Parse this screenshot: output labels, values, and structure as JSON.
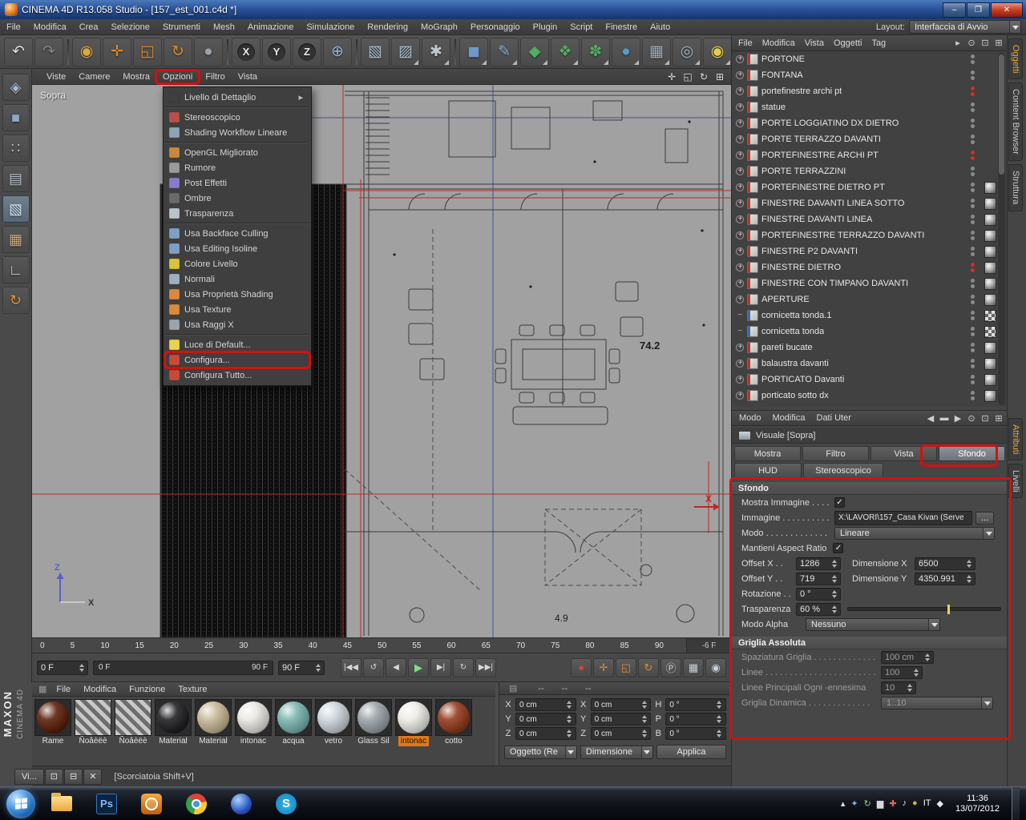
{
  "window": {
    "title": "CINEMA 4D R13.058 Studio - [157_est_001.c4d *]",
    "controls": [
      {
        "name": "minimize",
        "glyph": "–"
      },
      {
        "name": "maximize",
        "glyph": "❐"
      },
      {
        "name": "close",
        "glyph": "✕"
      }
    ]
  },
  "menubar": {
    "items": [
      "File",
      "Modifica",
      "Crea",
      "Selezione",
      "Strumenti",
      "Mesh",
      "Animazione",
      "Simulazione",
      "Rendering",
      "MoGraph",
      "Personaggio",
      "Plugin",
      "Script",
      "Finestre",
      "Aiuto"
    ],
    "layout_label": "Layout:",
    "layout_value": "Interfaccia di Avvio"
  },
  "toolbar": {
    "buttons": [
      {
        "name": "undo",
        "glyph": "↶",
        "color": "#d8dce0"
      },
      {
        "name": "redo",
        "glyph": "↷",
        "color": "#85878a"
      },
      {
        "sep": true
      },
      {
        "name": "live-selection",
        "glyph": "◉",
        "color": "#dca83c"
      },
      {
        "name": "move",
        "glyph": "✛",
        "color": "#e08a2e"
      },
      {
        "name": "scale",
        "glyph": "◱",
        "color": "#e08a2e"
      },
      {
        "name": "rotate",
        "glyph": "↻",
        "color": "#e08a2e"
      },
      {
        "name": "last-tool",
        "glyph": "●",
        "color": "#9aa2aa"
      },
      {
        "sep": true
      },
      {
        "name": "lock-x",
        "glyph": "X",
        "color": "#e8e8e8",
        "badge": true
      },
      {
        "name": "lock-y",
        "glyph": "Y",
        "color": "#e8e8e8",
        "badge": true
      },
      {
        "name": "lock-z",
        "glyph": "Z",
        "color": "#e8e8e8",
        "badge": true
      },
      {
        "name": "coord-system",
        "glyph": "⊕",
        "color": "#8fb3d8"
      },
      {
        "sep": true
      },
      {
        "name": "render-view",
        "glyph": "▧",
        "color": "#a8c0d0"
      },
      {
        "name": "render-picture-viewer",
        "glyph": "▨",
        "color": "#a8c0d0",
        "dropdown": true
      },
      {
        "name": "render-settings",
        "glyph": "✱",
        "color": "#c0c8d0",
        "dropdown": true
      },
      {
        "sep": true
      },
      {
        "name": "add-cube",
        "glyph": "◼",
        "color": "#6f97cc",
        "dropdown": true
      },
      {
        "name": "add-spline",
        "glyph": "✎",
        "color": "#7fb3e0",
        "dropdown": true
      },
      {
        "name": "add-generator",
        "glyph": "◆",
        "color": "#4fae62",
        "dropdown": true
      },
      {
        "name": "add-modeling",
        "glyph": "❖",
        "color": "#4fae62",
        "dropdown": true
      },
      {
        "name": "add-deformer",
        "glyph": "✽",
        "color": "#4fae62",
        "dropdown": true
      },
      {
        "name": "add-environment",
        "glyph": "●",
        "color": "#4f9ecc",
        "dropdown": true
      },
      {
        "name": "add-stage",
        "glyph": "▦",
        "color": "#9fb0c0",
        "dropdown": true
      },
      {
        "name": "add-camera",
        "glyph": "◎",
        "color": "#9fb0c0",
        "dropdown": true
      },
      {
        "name": "add-light",
        "glyph": "◉",
        "color": "#e8cc4a",
        "dropdown": true
      }
    ]
  },
  "left_palette": {
    "buttons": [
      {
        "name": "make-editable",
        "glyph": "◈",
        "color": "#a8b8c8"
      },
      {
        "name": "model-mode",
        "glyph": "■",
        "color": "#8fa8c8"
      },
      {
        "name": "point-mode",
        "glyph": "∷",
        "color": "#b8c0c8"
      },
      {
        "name": "edge-mode",
        "glyph": "▤",
        "color": "#b8c0c8"
      },
      {
        "name": "polygon-mode",
        "glyph": "▧",
        "color": "#d8e8f8",
        "active": true
      },
      {
        "name": "texture-mode",
        "glyph": "▦",
        "color": "#c8a87f"
      },
      {
        "name": "workplane-mode",
        "glyph": "∟",
        "color": "#d0d0d0"
      },
      {
        "name": "axis-mode",
        "glyph": "↻",
        "color": "#e0922e"
      }
    ]
  },
  "viewport": {
    "label": "Sopra",
    "menus": [
      {
        "label": "Viste"
      },
      {
        "label": "Camere"
      },
      {
        "label": "Mostra"
      },
      {
        "label": "Opzioni",
        "boxed": true
      },
      {
        "label": "Filtro"
      },
      {
        "label": "Vista"
      }
    ],
    "corner_icons": [
      {
        "name": "pan-view-icon",
        "glyph": "✛"
      },
      {
        "name": "zoom-view-icon",
        "glyph": "◱"
      },
      {
        "name": "rotate-view-icon",
        "glyph": "↻"
      },
      {
        "name": "maximize-view-icon",
        "glyph": "⊞"
      }
    ],
    "dim_a": "74.2",
    "dim_b": "4.9",
    "axis_x": "X",
    "axis_z": "Z",
    "red_axis_label": "X"
  },
  "options_menu": {
    "items": [
      {
        "label": "Livello di Dettaglio",
        "submenu": true,
        "group_end": true
      },
      {
        "label": "Stereoscopico",
        "icon_color": "#b85048"
      },
      {
        "label": "Shading Workflow Lineare",
        "icon_color": "#8fa3b8",
        "group_end": true
      },
      {
        "label": "OpenGL Migliorato",
        "icon_color": "#c9893a"
      },
      {
        "label": "Rumore",
        "icon_color": "#9a9a9a"
      },
      {
        "label": "Post Effetti",
        "icon_color": "#8a7ac9"
      },
      {
        "label": "Ombre",
        "icon_color": "#6a6a6a"
      },
      {
        "label": "Trasparenza",
        "icon_color": "#b8c4cc",
        "group_end": true
      },
      {
        "label": "Usa Backface Culling",
        "icon_color": "#7f9fc4"
      },
      {
        "label": "Usa Editing Isoline",
        "icon_color": "#7f9fc4"
      },
      {
        "label": "Colore Livello",
        "icon_color": "#d9c43a"
      },
      {
        "label": "Normali",
        "icon_color": "#9ab0c4"
      },
      {
        "label": "Usa Proprietà Shading",
        "icon_color": "#d98a3a"
      },
      {
        "label": "Usa Texture",
        "icon_color": "#d98a3a"
      },
      {
        "label": "Usa Raggi X",
        "icon_color": "#9aa5ad",
        "group_end": true
      },
      {
        "label": "Luce di Default...",
        "icon_color": "#e8d44a"
      },
      {
        "label": "Configura...",
        "icon_color": "#c94a3a",
        "boxed": true
      },
      {
        "label": "Configura Tutto...",
        "icon_color": "#c94a3a"
      }
    ]
  },
  "ruler": {
    "ticks": [
      "0",
      "5",
      "10",
      "15",
      "20",
      "25",
      "30",
      "35",
      "40",
      "45",
      "50",
      "55",
      "60",
      "65",
      "70",
      "75",
      "80",
      "85",
      "90"
    ],
    "end_label": "-6 F"
  },
  "timeline": {
    "current": "0 F",
    "range_start": "0 F",
    "range_end": "90 F",
    "end_value": "90 F",
    "playback": [
      {
        "name": "goto-start",
        "glyph": "|◀◀"
      },
      {
        "name": "play-backwards",
        "glyph": "↺"
      },
      {
        "name": "prev-frame",
        "glyph": "◀"
      },
      {
        "name": "play",
        "glyph": "▶",
        "green": true
      },
      {
        "name": "next-frame",
        "glyph": "▶|"
      },
      {
        "name": "play-loop",
        "glyph": "↻"
      },
      {
        "name": "goto-end",
        "glyph": "▶▶|"
      }
    ],
    "record": [
      {
        "name": "record-keyframe",
        "glyph": "●",
        "color": "#d8433a"
      },
      {
        "name": "record-position",
        "glyph": "✛",
        "color": "#e0892e"
      },
      {
        "name": "record-scale",
        "glyph": "◱",
        "color": "#e0892e"
      },
      {
        "name": "record-rotation",
        "glyph": "↻",
        "color": "#e0892e"
      },
      {
        "name": "record-parameter",
        "glyph": "Ⓟ",
        "color": "#c8d0d8"
      },
      {
        "name": "keyframe-selection",
        "glyph": "▦",
        "color": "#c8d0d8"
      },
      {
        "name": "autokey",
        "glyph": "◉",
        "color": "#c8d0d8"
      }
    ]
  },
  "materials": {
    "menus": [
      "File",
      "Modifica",
      "Funzione",
      "Texture"
    ],
    "items": [
      {
        "name": "Rame",
        "color": "#5a1d08"
      },
      {
        "name": "Ñoâèëè",
        "hatch": true
      },
      {
        "name": "Ñoâèëè",
        "hatch": true
      },
      {
        "name": "Material",
        "color": "#1d1d20"
      },
      {
        "name": "Material",
        "color": "#c7b795"
      },
      {
        "name": "intonac",
        "color": "#e9e7e1"
      },
      {
        "name": "acqua",
        "color": "#79b5af"
      },
      {
        "name": "vetro",
        "color": "#ccd5db"
      },
      {
        "name": "Glass Sil",
        "color": "#9aa2a8"
      },
      {
        "name": "intonac",
        "color": "#edebe5",
        "selected": true
      },
      {
        "name": "cotto",
        "color": "#93391b"
      }
    ]
  },
  "coordinates": {
    "header_dash": "--",
    "position": {
      "labels": [
        "X",
        "Y",
        "Z"
      ],
      "values": [
        "0 cm",
        "0 cm",
        "0 cm"
      ]
    },
    "size": {
      "labels": [
        "X",
        "Y",
        "Z"
      ],
      "values": [
        "0 cm",
        "0 cm",
        "0 cm"
      ]
    },
    "rotation": {
      "labels": [
        "H",
        "P",
        "B"
      ],
      "values": [
        "0 °",
        "0 °",
        "0 °"
      ]
    },
    "mode1": "Oggetto (Re",
    "mode2": "Dimensione",
    "apply": "Applica"
  },
  "object_manager": {
    "menus": [
      "File",
      "Modifica",
      "Vista",
      "Oggetti",
      "Tag"
    ],
    "icons": [
      {
        "name": "overflow-arrow-icon",
        "glyph": "▸"
      },
      {
        "name": "search-icon",
        "glyph": "⊙"
      },
      {
        "name": "lock-icon",
        "glyph": "⊡"
      },
      {
        "name": "layout-icon",
        "glyph": "⊞"
      }
    ],
    "objects": [
      {
        "name": "PORTONE"
      },
      {
        "name": "FONTANA"
      },
      {
        "name": "portefinestre archi pt",
        "dots_red": true
      },
      {
        "name": "statue"
      },
      {
        "name": "PORTE LOGGIATINO DX DIETRO"
      },
      {
        "name": "PORTE TERRAZZO DAVANTI"
      },
      {
        "name": "PORTEFINESTRE ARCHI PT",
        "dots_red": true
      },
      {
        "name": "PORTE TERRAZZINI"
      },
      {
        "name": "PORTEFINESTRE DIETRO PT",
        "has_mat": true
      },
      {
        "name": "FINESTRE DAVANTI LINEA SOTTO",
        "has_mat": true
      },
      {
        "name": "FINESTRE DAVANTI LINEA",
        "has_mat": true
      },
      {
        "name": "PORTEFINESTRE TERRAZZO DAVANTI",
        "has_mat": true
      },
      {
        "name": "FINESTRE P2 DAVANTI",
        "has_mat": true
      },
      {
        "name": "FINESTRE DIETRO",
        "dots_red": true,
        "has_mat": true
      },
      {
        "name": "FINESTRE CON TIMPANO DAVANTI",
        "has_mat": true
      },
      {
        "name": "APERTURE",
        "has_mat": true
      },
      {
        "name": "cornicetta tonda.1",
        "has_mat": true,
        "checker": true,
        "spline": true
      },
      {
        "name": "cornicetta tonda",
        "has_mat": true,
        "checker": true,
        "spline": true
      },
      {
        "name": "pareti bucate",
        "has_mat": true
      },
      {
        "name": "balaustra davanti",
        "has_mat": true
      },
      {
        "name": "PORTICATO Davanti",
        "has_mat": true
      },
      {
        "name": "porticato sotto dx",
        "has_mat": true
      }
    ]
  },
  "side_tabs": {
    "top": [
      {
        "label": "Oggetti",
        "active": true
      },
      {
        "label": "Content Browser"
      },
      {
        "label": "Struttura"
      }
    ],
    "bottom": [
      {
        "label": "Attributi",
        "active": true
      },
      {
        "label": "Livelli"
      }
    ]
  },
  "attributes": {
    "menus": [
      "Modo",
      "Modifica",
      "Dati Uter"
    ],
    "icons": [
      {
        "name": "back-icon",
        "glyph": "◀"
      },
      {
        "name": "mode-block-icon",
        "glyph": "▬"
      },
      {
        "name": "forward-icon",
        "glyph": "▶"
      },
      {
        "name": "search-icon",
        "glyph": "⊙"
      },
      {
        "name": "lock-icon",
        "glyph": "⊡"
      },
      {
        "name": "layout-icon",
        "glyph": "⊞"
      }
    ],
    "title": "Visuale [Sopra]",
    "tabs_row1": [
      "Mostra",
      "Filtro",
      "Vista",
      "Sfondo"
    ],
    "tabs_row2": [
      "HUD",
      "Stereoscopico"
    ],
    "active_tab": "Sfondo",
    "sfondo": {
      "header": "Sfondo",
      "mostra_immagine_label": "Mostra Immagine . . . .",
      "immagine_label": "Immagine . . . . . . . . . .",
      "immagine_value": "X:\\LAVORI\\157_Casa Kivan (Serve",
      "browse_label": "...",
      "modo_label": "Modo . . . . . . . . . . . . .",
      "modo_value": "Lineare",
      "aspect_label": "Mantieni Aspect Ratio",
      "offset_x_label": "Offset X . .",
      "offset_x_value": "1286",
      "dim_x_label": "Dimensione X",
      "dim_x_value": "6500",
      "offset_y_label": "Offset Y . .",
      "offset_y_value": "719",
      "dim_y_label": "Dimensione Y",
      "dim_y_value": "4350.991",
      "rot_label": "Rotazione . .",
      "rot_value": "0 °",
      "trasp_label": "Trasparenza",
      "trasp_value": "60 %",
      "alpha_label": "Modo Alpha",
      "alpha_value": "Nessuno"
    },
    "griglia": {
      "header": "Griglia Assoluta",
      "spaziatura_label": "Spaziatura Griglia . . . . . . . . . . . . .",
      "spaziatura_value": "100 cm",
      "linee_label": "Linee . . . . . . . . . . . . . . . . . . . . . . . .",
      "linee_value": "100",
      "principali_label": "Linee Principali Ogni -ennesima",
      "principali_value": "10",
      "dinamica_label": "Griglia Dinamica . . . . . . . . . . . . .",
      "dinamica_value": "1..10"
    }
  },
  "statusbar": {
    "mini_tab": "Vi...",
    "mini_icons": [
      {
        "name": "restore-icon",
        "glyph": "⊡"
      },
      {
        "name": "minimize-icon",
        "glyph": "⊟"
      },
      {
        "name": "close-icon",
        "glyph": "✕"
      }
    ],
    "shortcut": "[Scorciatoia Shift+V]"
  },
  "brand": {
    "maxon": "MAXON",
    "cinema": "CINEMA 4D"
  },
  "taskbar": {
    "photoshop_label": "Ps",
    "skype_label": "S",
    "tray": [
      {
        "name": "hidden-icons",
        "glyph": "▴",
        "color": "#e0e0e0"
      },
      {
        "name": "bluetooth",
        "glyph": "✦",
        "color": "#7fb3e8"
      },
      {
        "name": "sync",
        "glyph": "↻",
        "color": "#8fd08f"
      },
      {
        "name": "network",
        "glyph": "▆",
        "color": "#d8d8d8"
      },
      {
        "name": "antivirus",
        "glyph": "✚",
        "color": "#e06a5a"
      },
      {
        "name": "volume",
        "glyph": "♪",
        "color": "#e8e8e8"
      },
      {
        "name": "updates",
        "glyph": "●",
        "color": "#d8b03a"
      },
      {
        "name": "language",
        "glyph": "IT",
        "color": "#ffffff"
      },
      {
        "name": "action-center",
        "glyph": "◆",
        "color": "#e8e8e8"
      }
    ],
    "time": "11:36",
    "date": "13/07/2012"
  }
}
